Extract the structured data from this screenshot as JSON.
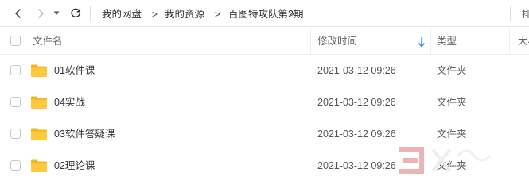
{
  "nav": {
    "back_icon": "chevron-left-icon",
    "forward_icon": "chevron-right-icon",
    "history_icon": "caret-down-icon",
    "refresh_icon": "refresh-icon",
    "breadcrumb": [
      "我的网盘",
      "我的资源",
      "百图特攻队第2期"
    ],
    "separator": ">",
    "right_text": "排"
  },
  "columns": {
    "name": "文件名",
    "modified": "修改时间",
    "type": "类型",
    "size": "大小",
    "sort_icon": "sort-down-arrow-icon"
  },
  "files": [
    {
      "name": "01软件课",
      "modified": "2021-03-12 09:26",
      "type": "文件夹",
      "icon": "folder-icon"
    },
    {
      "name": "04实战",
      "modified": "2021-03-12 09:26",
      "type": "文件夹",
      "icon": "folder-icon"
    },
    {
      "name": "03软件答疑课",
      "modified": "2021-03-12 09:26",
      "type": "文件夹",
      "icon": "folder-icon"
    },
    {
      "name": "02理论课",
      "modified": "2021-03-12 09:26",
      "type": "文件夹",
      "icon": "folder-icon"
    }
  ],
  "colors": {
    "folder": "#ffc93c",
    "folder_tab": "#f5b31f",
    "sort_arrow": "#3b8fe0",
    "watermark": "#e8a8a8"
  }
}
